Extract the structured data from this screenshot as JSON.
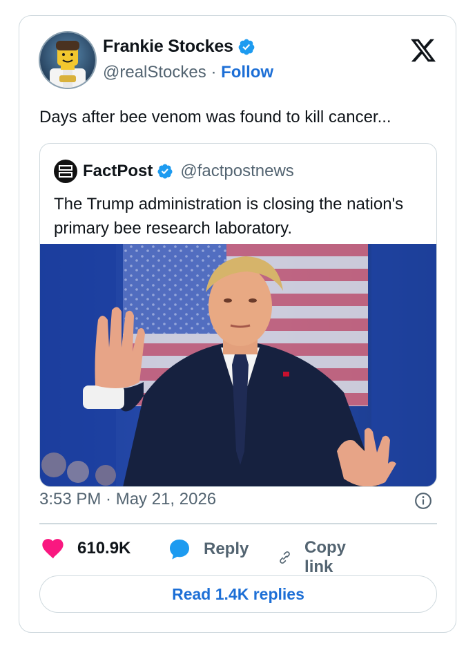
{
  "author": {
    "name": "Frankie Stockes",
    "handle": "@realStockes",
    "separator": "·",
    "follow_label": "Follow",
    "avatar_icon": "lego-figure-avatar",
    "verified_icon": "verified-badge-icon"
  },
  "platform_icon": "x-logo-icon",
  "tweet_text": "Days after bee venom was found to kill cancer...",
  "quoted": {
    "name": "FactPost",
    "handle": "@factpostnews",
    "avatar_icon": "factpost-logo",
    "text": "The Trump administration is closing the nation's primary bee research laboratory.",
    "photo_alt": "Man in dark suit raising both hands in front of an American flag"
  },
  "timestamp": "3:53 PM · May 21, 2026",
  "actions": {
    "like_count": "610.9K",
    "reply_label": "Reply",
    "copy_label": "Copy link"
  },
  "read_replies_label": "Read 1.4K replies",
  "colors": {
    "accent_blue": "#1d6fd6",
    "verified_blue": "#1d9bf0",
    "heart_pink": "#f91880",
    "secondary_text": "#536471",
    "border": "#cfd9de"
  }
}
